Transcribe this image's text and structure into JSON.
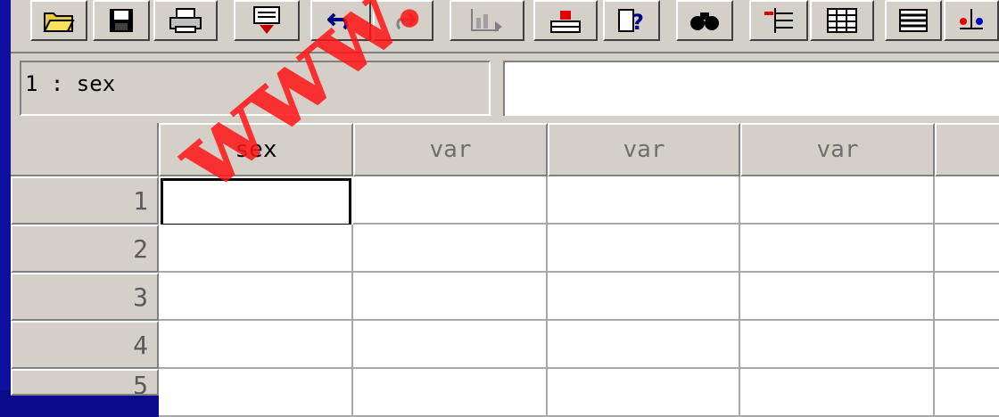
{
  "toolbar": {
    "buttons": [
      {
        "name": "open-file-icon",
        "glyph": "📂"
      },
      {
        "name": "save-icon",
        "glyph": "💾"
      },
      {
        "name": "print-icon",
        "glyph": "🖨"
      },
      {
        "name": "dialog-recall-icon",
        "glyph": "▤"
      },
      {
        "name": "undo-icon",
        "glyph": "↶"
      },
      {
        "name": "redo-icon",
        "glyph": "↷"
      },
      {
        "name": "goto-chart-icon",
        "glyph": "▥"
      },
      {
        "name": "goto-case-icon",
        "glyph": "▬"
      },
      {
        "name": "variables-icon",
        "glyph": "?"
      },
      {
        "name": "find-icon",
        "glyph": "🔍"
      },
      {
        "name": "insert-case-icon",
        "glyph": "⇥"
      },
      {
        "name": "insert-variable-icon",
        "glyph": "▦"
      },
      {
        "name": "split-file-icon",
        "glyph": "☰"
      },
      {
        "name": "weight-cases-icon",
        "glyph": "⚖"
      }
    ]
  },
  "cell_reference": {
    "label": "1 : sex",
    "value": ""
  },
  "grid": {
    "columns": [
      "sex",
      "var",
      "var",
      "var",
      ""
    ],
    "rows": [
      "1",
      "2",
      "3",
      "4",
      "5"
    ]
  },
  "watermark": {
    "text": "www.*pn"
  },
  "colors": {
    "window_frame": "#0a0a8c",
    "chrome": "#d4d0c8",
    "watermark": "#ff1414"
  }
}
